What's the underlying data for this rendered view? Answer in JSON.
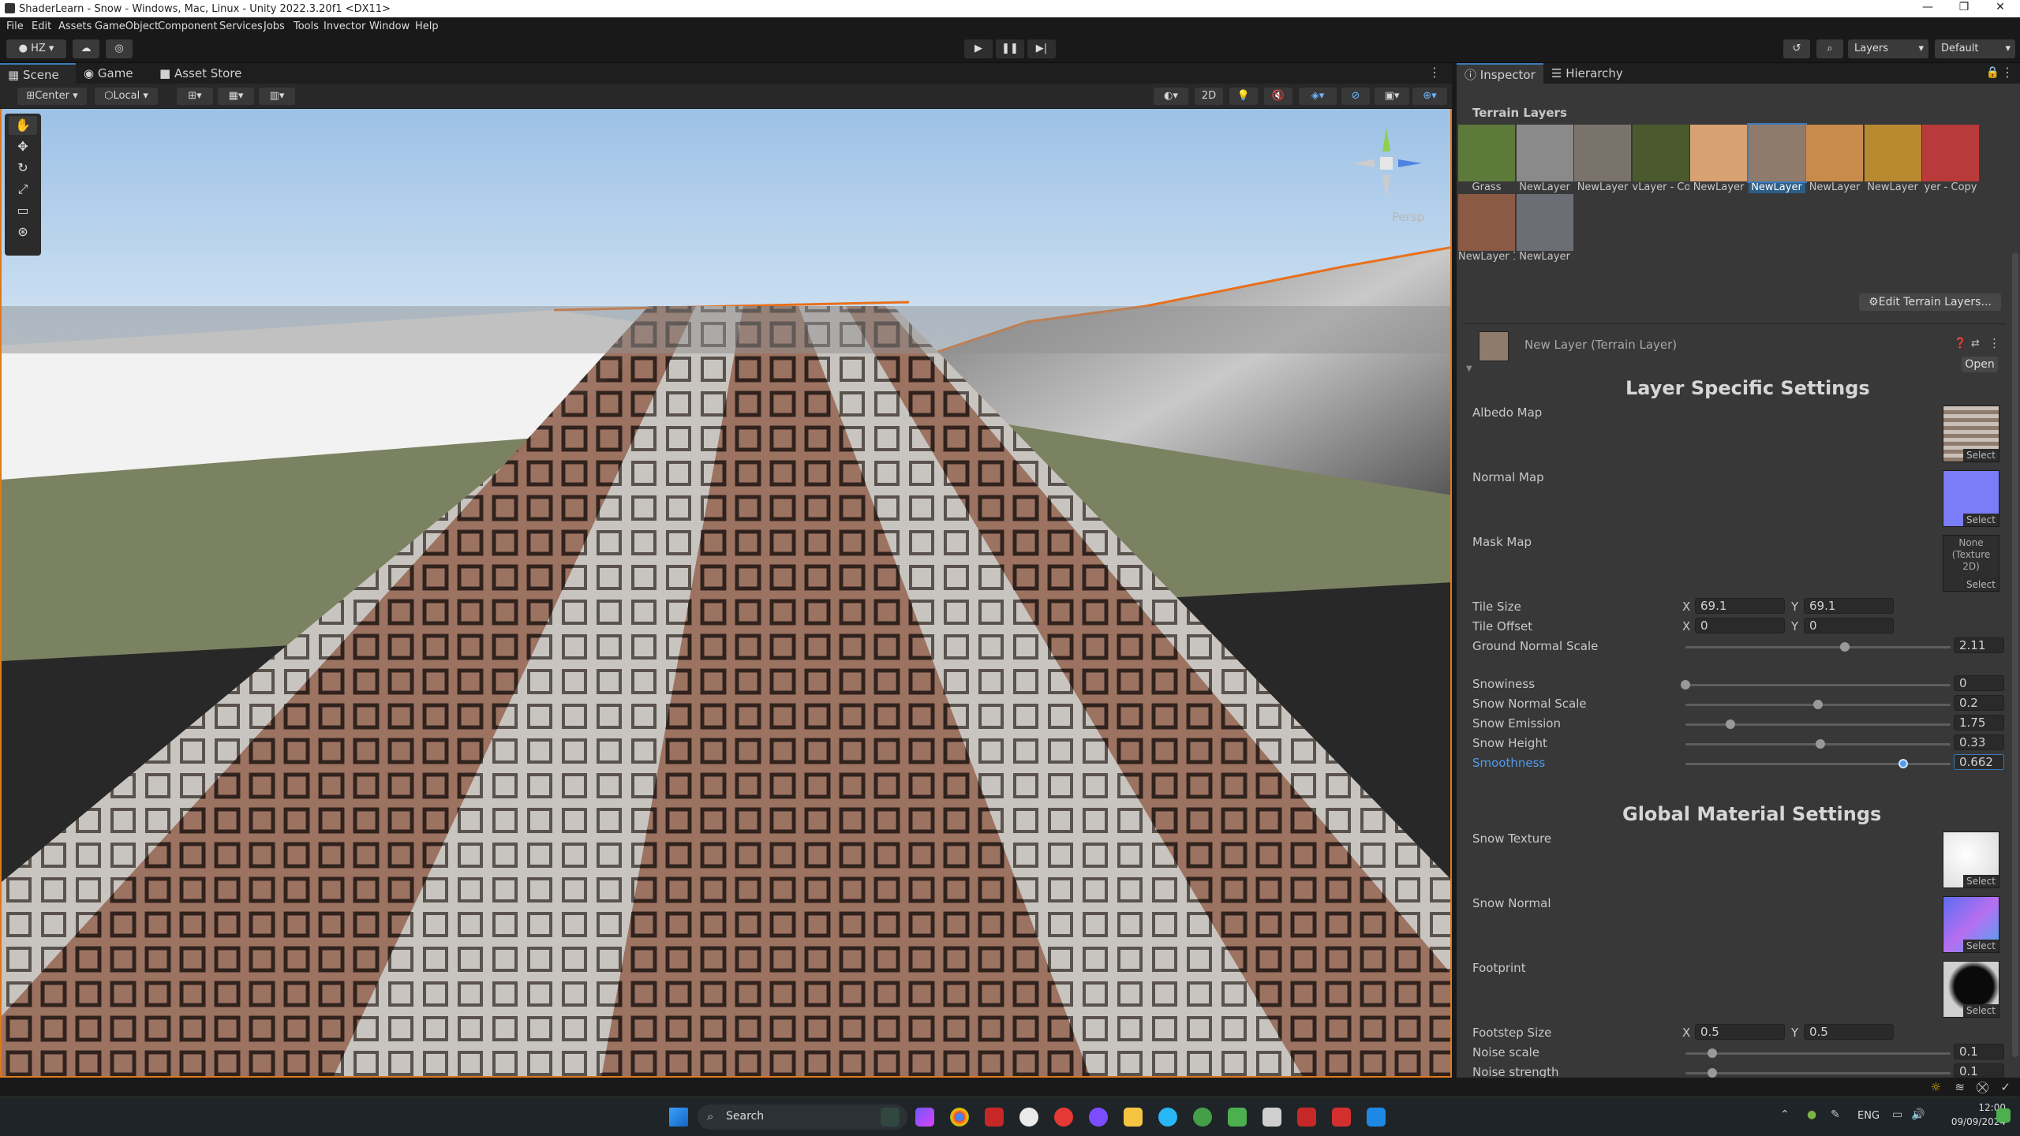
{
  "window": {
    "title": "ShaderLearn - Snow - Windows, Mac, Linux - Unity 2022.3.20f1 <DX11>",
    "controls": [
      "—",
      "❐",
      "✕"
    ]
  },
  "menu": [
    "File",
    "Edit",
    "Assets",
    "GameObject",
    "Component",
    "Services",
    "Jobs",
    "Tools",
    "Invector",
    "Window",
    "Help"
  ],
  "toolbar": {
    "account": "HZ",
    "layers": "Layers",
    "layout": "Default"
  },
  "scene_panel": {
    "tabs": [
      "Scene",
      "Game",
      "Asset Store"
    ],
    "pivot_mode": "Center",
    "pivot_rotation": "Local",
    "mode_2d": "2D",
    "gizmo_view": "Persp"
  },
  "inspector": {
    "tabs": [
      "Inspector",
      "Hierarchy"
    ],
    "terrain_layers_title": "Terrain Layers",
    "terrain_layers": [
      {
        "name": "Grass",
        "color": "#5d7a3a"
      },
      {
        "name": "NewLayer",
        "color": "#8a8a8a"
      },
      {
        "name": "NewLayer",
        "color": "#7a736b"
      },
      {
        "name": "vLayer - Co",
        "color": "#4a5a2c"
      },
      {
        "name": "NewLayer",
        "color": "#d7a172"
      },
      {
        "name": "NewLayer",
        "color": "#8f7b6c",
        "selected": true
      },
      {
        "name": "NewLayer",
        "color": "#c98b4b"
      },
      {
        "name": "NewLayer",
        "color": "#b8892f"
      },
      {
        "name": "yer - Copy",
        "color": "#b83a3a"
      },
      {
        "name": "NewLayer 1",
        "color": "#8a5a44"
      },
      {
        "name": "NewLayer",
        "color": "#6b6e74"
      }
    ],
    "edit_button": "Edit Terrain Layers...",
    "layer_asset_name": "New Layer (Terrain Layer)",
    "open_button": "Open",
    "layer_section_title": "Layer Specific Settings",
    "albedo_label": "Albedo Map",
    "normal_label": "Normal Map",
    "mask_label": "Mask Map",
    "mask_none": "None (Texture 2D)",
    "select_label": "Select",
    "tile_size_label": "Tile Size",
    "tile_offset_label": "Tile Offset",
    "tile_size": {
      "x": "69.1",
      "y": "69.1"
    },
    "tile_offset": {
      "x": "0",
      "y": "0"
    },
    "axis_x": "X",
    "axis_y": "Y",
    "sliders": [
      {
        "label": "Ground Normal Scale",
        "value": "2.11",
        "fraction": 0.6
      },
      {
        "label": "Snowiness",
        "value": "0",
        "fraction": 0.0
      },
      {
        "label": "Snow Normal Scale",
        "value": "0.2",
        "fraction": 0.5
      },
      {
        "label": "Snow Emission",
        "value": "1.75",
        "fraction": 0.17
      },
      {
        "label": "Snow Height",
        "value": "0.33",
        "fraction": 0.51
      },
      {
        "label": "Smoothness",
        "value": "0.662",
        "fraction": 0.82,
        "active": true
      }
    ],
    "global_section_title": "Global Material Settings",
    "snow_texture_label": "Snow Texture",
    "snow_normal_label": "Snow Normal",
    "footprint_label": "Footprint",
    "footstep_size_label": "Footstep Size",
    "footstep_size": {
      "x": "0.5",
      "y": "0.5"
    },
    "noise_sliders": [
      {
        "label": "Noise scale",
        "value": "0.1",
        "fraction": 0.1
      },
      {
        "label": "Noise strength",
        "value": "0.1",
        "fraction": 0.1
      }
    ]
  },
  "taskbar": {
    "search_placeholder": "Search",
    "lang": "ENG",
    "time": "12:00",
    "date": "09/09/2024"
  }
}
